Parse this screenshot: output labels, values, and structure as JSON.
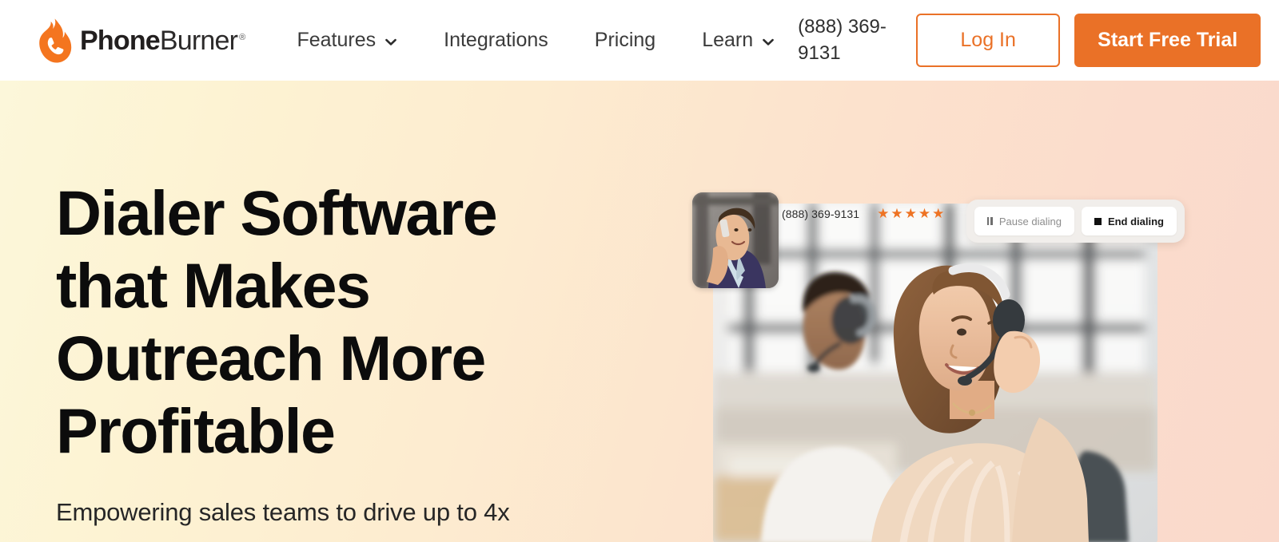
{
  "header": {
    "brand": {
      "icon": "flame-phone-logo",
      "name_bold": "Phone",
      "name_light": "Burner",
      "registered_mark": "®"
    },
    "nav": [
      {
        "label": "Features",
        "has_dropdown": true,
        "icon": "chevron-down-icon"
      },
      {
        "label": "Integrations",
        "has_dropdown": false,
        "icon": ""
      },
      {
        "label": "Pricing",
        "has_dropdown": false,
        "icon": ""
      },
      {
        "label": "Learn",
        "has_dropdown": true,
        "icon": "chevron-down-icon"
      }
    ],
    "phone": "(888) 369-9131",
    "login_label": "Log In",
    "trial_label": "Start Free Trial"
  },
  "hero": {
    "title_lines": [
      "Dialer Software",
      "that Makes",
      "Outreach More",
      "Profitable"
    ],
    "subtitle": "Empowering sales teams to drive up to 4x",
    "visual": {
      "avatar_alt": "man-on-phone-avatar",
      "photo_alt": "call-center-agents-with-headsets",
      "caller_number": "(888) 369-9131",
      "rating_stars": 5,
      "star_glyph": "★",
      "controls": [
        {
          "label": "Pause dialing",
          "icon": "pause-icon"
        },
        {
          "label": "End dialing",
          "icon": "stop-icon"
        }
      ]
    }
  },
  "colors": {
    "brand_orange": "#ea7127",
    "star_orange": "#ee7324",
    "text_dark": "#0c0c0c",
    "nav_text": "#3b3b3b",
    "gradient_start": "#fcf7da",
    "gradient_end": "#fad9cb"
  }
}
